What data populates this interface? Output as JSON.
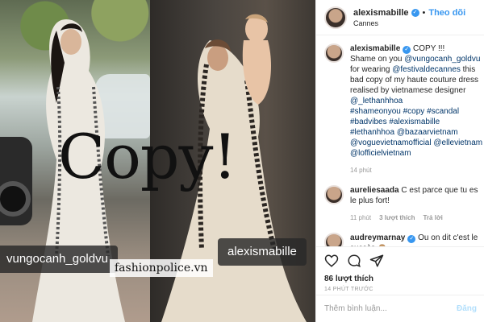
{
  "media": {
    "overlay_text": "Copy!",
    "tag_left": "vungocanh_goldvu",
    "tag_right": "alexismabille",
    "watermark": "fashionpolice.vn"
  },
  "header": {
    "username": "alexismabille",
    "follow_label": "Theo dõi",
    "location": "Cannes"
  },
  "caption": {
    "username": "alexismabille",
    "text_1": " COPY !!!",
    "text_2": "Shame on you ",
    "mention_1": "@vungocanh_goldvu",
    "text_3": " for wearing ",
    "mention_2": "@festivaldecannes",
    "text_4": " this bad copy of my haute couture dress realised by vietnamese designer ",
    "mention_3": "@_lethanhhoa",
    "hashtags": "#shameonyou #copy #scandal #badvibes #alexismabille #lethanhhoa @bazaarvietnam @voguevietnamofficial @ellevietnam @lofficielvietnam",
    "time": "14 phút"
  },
  "comments": [
    {
      "username": "aureliesaada",
      "text": " C est parce que tu es le plus fort!",
      "time": "11 phút",
      "likes": "3 lượt thích",
      "reply": "Trả lời"
    },
    {
      "username": "audreymarnay",
      "text": " Ou on dit c'est le succès 🙈"
    }
  ],
  "actions": {
    "likes": "86 lượt thích",
    "timestamp": "14 PHÚT TRƯỚC"
  },
  "add_comment": {
    "placeholder": "Thêm bình luận...",
    "post_label": "Đăng"
  },
  "colors": {
    "accent": "#3897f0",
    "link": "#003569",
    "muted": "#999999"
  }
}
